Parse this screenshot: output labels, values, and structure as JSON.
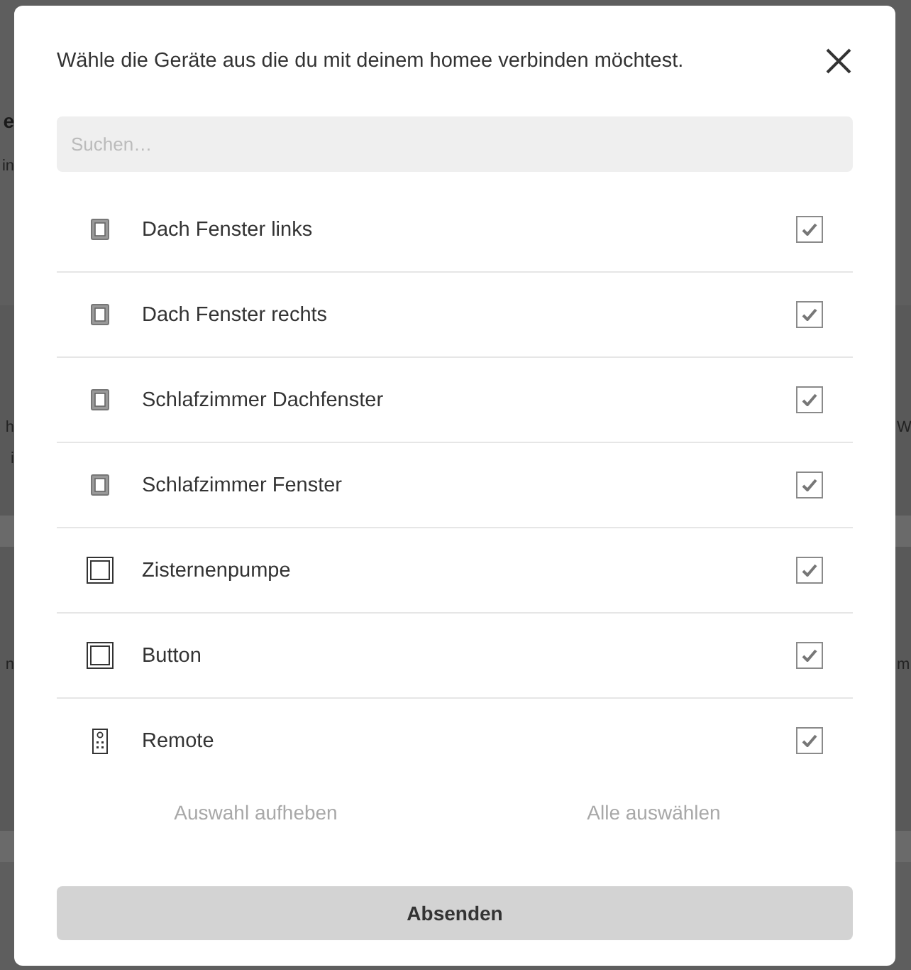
{
  "background": {
    "fragments_left": [
      {
        "text": "e",
        "kind": "heading"
      },
      {
        "text": "in",
        "kind": "text"
      },
      {
        "text": "h",
        "kind": "text"
      },
      {
        "text": "i",
        "kind": "text"
      },
      {
        "text": "n",
        "kind": "text"
      }
    ],
    "fragments_right": [
      {
        "text": "W"
      },
      {
        "text": "m"
      }
    ]
  },
  "dialog": {
    "title": "Wähle die Geräte aus die du mit deinem homee verbinden möchtest.",
    "search": {
      "placeholder": "Suchen…"
    },
    "devices": [
      {
        "name": "Dach Fenster links",
        "kind": "window",
        "checked": true
      },
      {
        "name": "Dach Fenster rechts",
        "kind": "window",
        "checked": true
      },
      {
        "name": "Schlafzimmer Dachfenster",
        "kind": "window",
        "checked": true
      },
      {
        "name": "Schlafzimmer Fenster",
        "kind": "window",
        "checked": true
      },
      {
        "name": "Zisternenpumpe",
        "kind": "switch",
        "checked": true
      },
      {
        "name": "Button",
        "kind": "switch",
        "checked": true
      },
      {
        "name": "Remote",
        "kind": "remote",
        "checked": true
      }
    ],
    "deselect_all": "Auswahl aufheben",
    "select_all": "Alle auswählen",
    "submit": "Absenden"
  }
}
